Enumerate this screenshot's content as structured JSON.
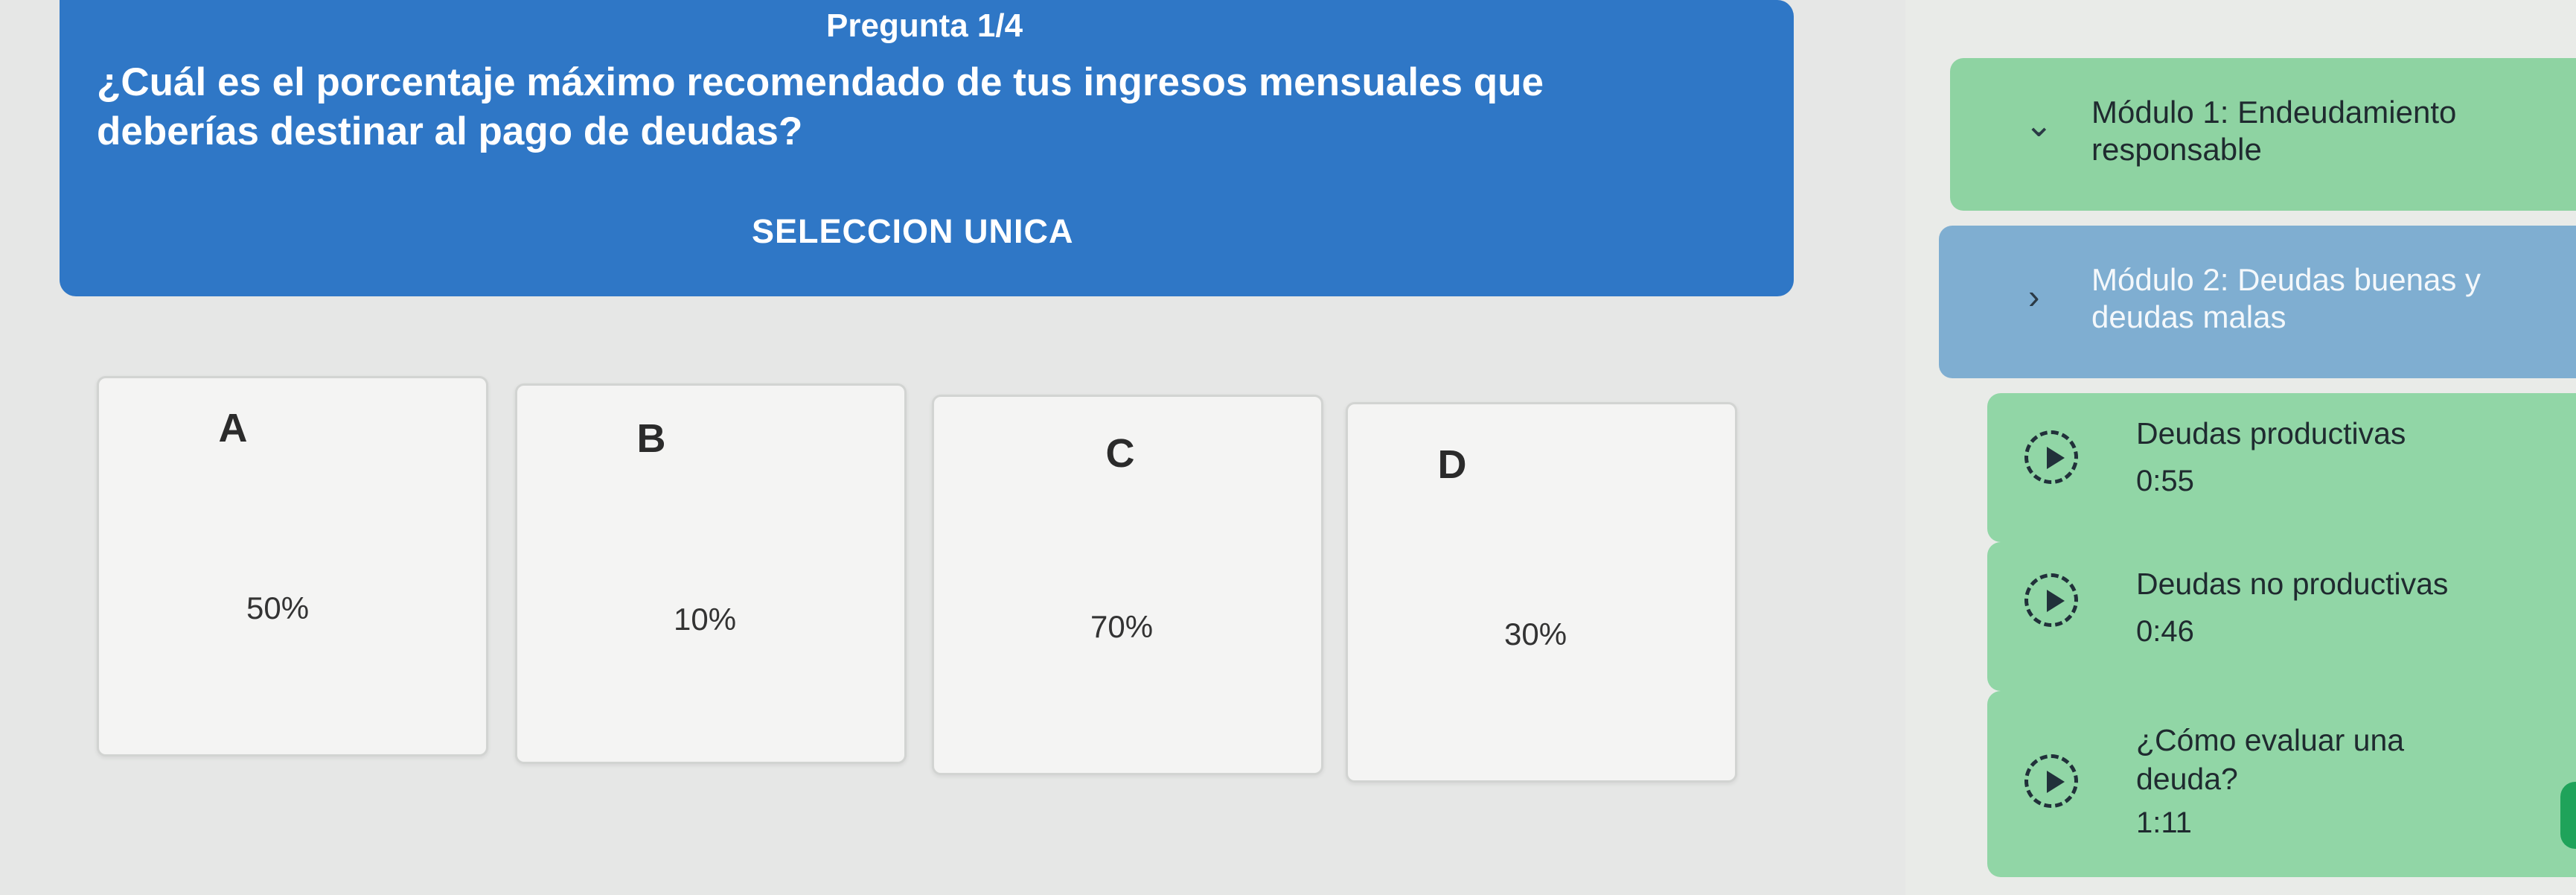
{
  "question": {
    "counter": "Pregunta 1/4",
    "text": "¿Cuál es el porcentaje máximo recomendado de tus ingresos mensuales que deberías destinar al pago de deudas?",
    "type": "SELECCION UNICA"
  },
  "options": [
    {
      "letter": "A",
      "value": "50%"
    },
    {
      "letter": "B",
      "value": "10%"
    },
    {
      "letter": "C",
      "value": "70%"
    },
    {
      "letter": "D",
      "value": "30%"
    }
  ],
  "sidebar": {
    "modules": [
      {
        "title": "Módulo 1: Endeudamiento responsable",
        "expanded": true,
        "color": "#8ed3a2"
      },
      {
        "title": "Módulo 2: Deudas buenas y deudas malas",
        "expanded": false,
        "color": "#7faed1"
      }
    ],
    "lessons": [
      {
        "title": "Deudas productivas",
        "duration": "0:55"
      },
      {
        "title": "Deudas no productivas",
        "duration": "0:46"
      },
      {
        "title": "¿Cómo evaluar una deuda?",
        "duration": "1:11"
      }
    ]
  },
  "colors": {
    "question_bg": "#2f77c6",
    "lesson_bg": "#91d6a6"
  }
}
